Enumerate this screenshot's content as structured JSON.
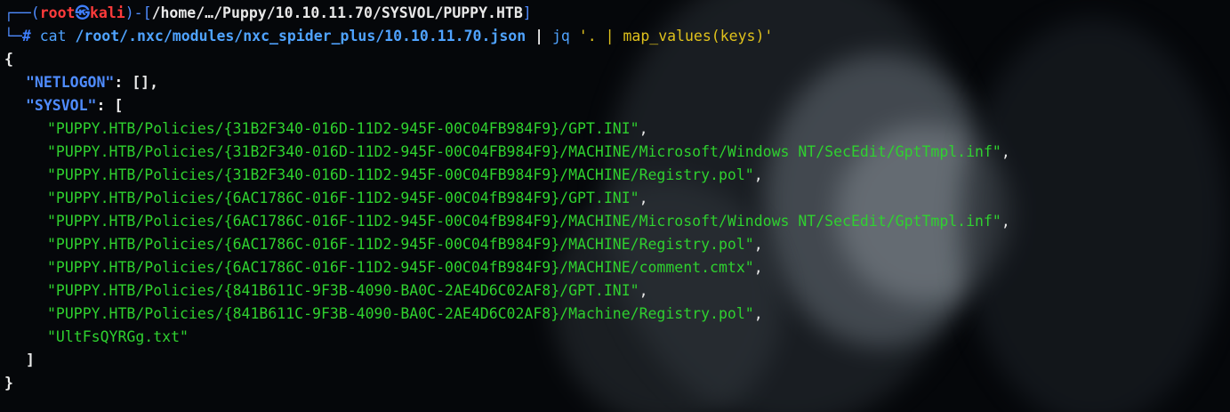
{
  "prompt": {
    "box_top_left": "┌──(",
    "user": "root",
    "at_symbol": "㉿",
    "host": "kali",
    "sep_open": ")-[",
    "cwd": "/home/…/Puppy/10.10.11.70/SYSVOL/PUPPY.HTB",
    "sep_close": "]",
    "box_bottom_left": "└─",
    "hash": "#"
  },
  "command": {
    "program": "cat",
    "path": "/root/.nxc/modules/nxc_spider_plus/10.10.11.70.json",
    "pipe": "|",
    "filter_program": "jq",
    "filter_quote_open": "'",
    "filter_dot": ".",
    "filter_pipe": "|",
    "filter_expr": "map_values(keys)",
    "filter_quote_close": "'"
  },
  "output": {
    "open_brace": "{",
    "netlogon_key": "\"NETLOGON\"",
    "netlogon_value": ": [],",
    "sysvol_key": "\"SYSVOL\"",
    "sysvol_open": ": [",
    "files": [
      "\"PUPPY.HTB/Policies/{31B2F340-016D-11D2-945F-00C04FB984F9}/GPT.INI\"",
      "\"PUPPY.HTB/Policies/{31B2F340-016D-11D2-945F-00C04FB984F9}/MACHINE/Microsoft/Windows NT/SecEdit/GptTmpl.inf\"",
      "\"PUPPY.HTB/Policies/{31B2F340-016D-11D2-945F-00C04FB984F9}/MACHINE/Registry.pol\"",
      "\"PUPPY.HTB/Policies/{6AC1786C-016F-11D2-945F-00C04fB984F9}/GPT.INI\"",
      "\"PUPPY.HTB/Policies/{6AC1786C-016F-11D2-945F-00C04fB984F9}/MACHINE/Microsoft/Windows NT/SecEdit/GptTmpl.inf\"",
      "\"PUPPY.HTB/Policies/{6AC1786C-016F-11D2-945F-00C04fB984F9}/MACHINE/Registry.pol\"",
      "\"PUPPY.HTB/Policies/{6AC1786C-016F-11D2-945F-00C04fB984F9}/MACHINE/comment.cmtx\"",
      "\"PUPPY.HTB/Policies/{841B611C-9F3B-4090-BA0C-2AE4D6C02AF8}/GPT.INI\"",
      "\"PUPPY.HTB/Policies/{841B611C-9F3B-4090-BA0C-2AE4D6C02AF8}/Machine/Registry.pol\"",
      "\"UltFsQYRGg.txt\""
    ],
    "comma": ",",
    "close_bracket": "]",
    "close_brace": "}"
  },
  "colors": {
    "background": "#05070a",
    "prompt_box": "#4f8cff",
    "user_host": "#ff3b3b",
    "path": "#4fa3ff",
    "json_key": "#4f8cff",
    "json_string": "#2fd12f",
    "filter": "#e0c21c"
  }
}
